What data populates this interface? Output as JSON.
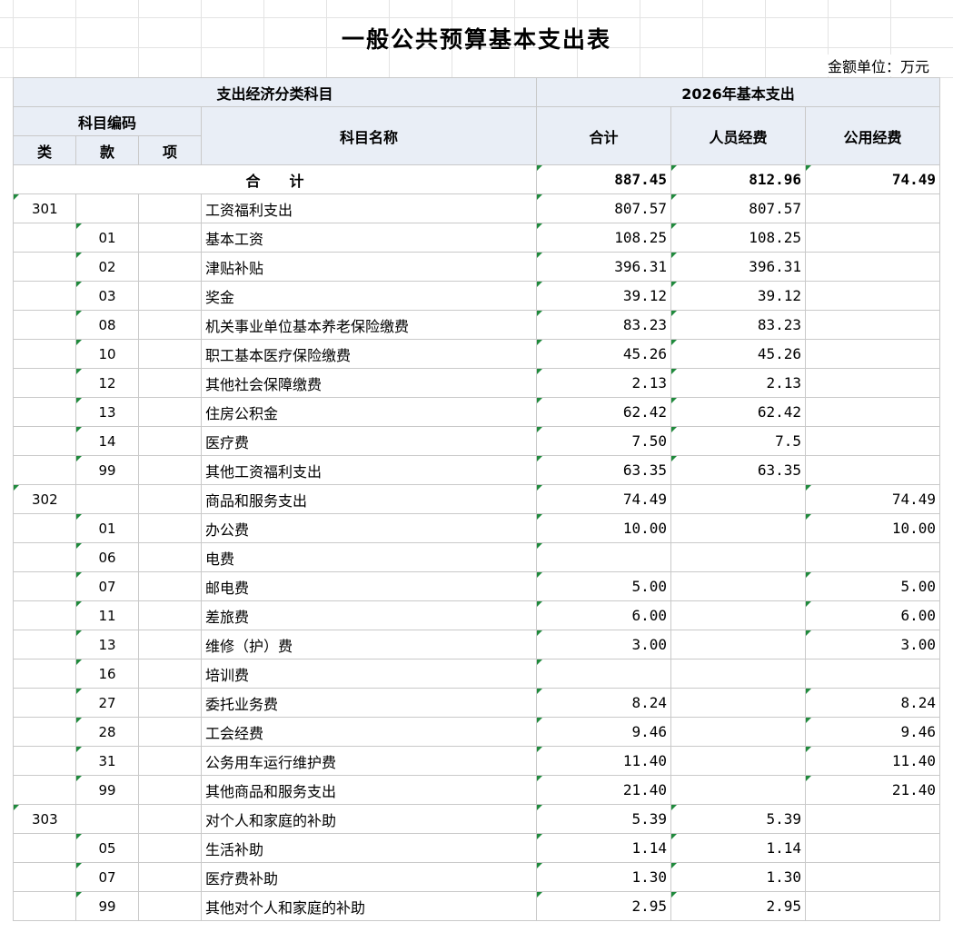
{
  "title": "一般公共预算基本支出表",
  "unit_label": "金额单位：万元",
  "header": {
    "econ_class": "支出经济分类科目",
    "year_group": "2026年基本支出",
    "code_group": "科目编码",
    "lei": "类",
    "kuan": "款",
    "xiang": "项",
    "subject_name": "科目名称",
    "total": "合计",
    "personnel": "人员经费",
    "public": "公用经费"
  },
  "total_row": {
    "label": "合　　计",
    "total": "887.45",
    "personnel": "812.96",
    "public": "74.49"
  },
  "rows": [
    {
      "lei": "301",
      "kuan": "",
      "name": "工资福利支出",
      "total": "807.57",
      "personnel": "807.57",
      "public": ""
    },
    {
      "lei": "",
      "kuan": "01",
      "name": "基本工资",
      "total": "108.25",
      "personnel": "108.25",
      "public": ""
    },
    {
      "lei": "",
      "kuan": "02",
      "name": "津贴补贴",
      "total": "396.31",
      "personnel": "396.31",
      "public": ""
    },
    {
      "lei": "",
      "kuan": "03",
      "name": "奖金",
      "total": "39.12",
      "personnel": "39.12",
      "public": ""
    },
    {
      "lei": "",
      "kuan": "08",
      "name": "机关事业单位基本养老保险缴费",
      "total": "83.23",
      "personnel": "83.23",
      "public": ""
    },
    {
      "lei": "",
      "kuan": "10",
      "name": "职工基本医疗保险缴费",
      "total": "45.26",
      "personnel": "45.26",
      "public": ""
    },
    {
      "lei": "",
      "kuan": "12",
      "name": "其他社会保障缴费",
      "total": "2.13",
      "personnel": "2.13",
      "public": ""
    },
    {
      "lei": "",
      "kuan": "13",
      "name": "住房公积金",
      "total": "62.42",
      "personnel": "62.42",
      "public": ""
    },
    {
      "lei": "",
      "kuan": "14",
      "name": "医疗费",
      "total": "7.50",
      "personnel": "7.5",
      "public": ""
    },
    {
      "lei": "",
      "kuan": "99",
      "name": "其他工资福利支出",
      "total": "63.35",
      "personnel": "63.35",
      "public": ""
    },
    {
      "lei": "302",
      "kuan": "",
      "name": "商品和服务支出",
      "total": "74.49",
      "personnel": "",
      "public": "74.49"
    },
    {
      "lei": "",
      "kuan": "01",
      "name": "办公费",
      "total": "10.00",
      "personnel": "",
      "public": "10.00"
    },
    {
      "lei": "",
      "kuan": "06",
      "name": "电费",
      "total": "",
      "personnel": "",
      "public": ""
    },
    {
      "lei": "",
      "kuan": "07",
      "name": "邮电费",
      "total": "5.00",
      "personnel": "",
      "public": "5.00"
    },
    {
      "lei": "",
      "kuan": "11",
      "name": "差旅费",
      "total": "6.00",
      "personnel": "",
      "public": "6.00"
    },
    {
      "lei": "",
      "kuan": "13",
      "name": "维修（护）费",
      "total": "3.00",
      "personnel": "",
      "public": "3.00"
    },
    {
      "lei": "",
      "kuan": "16",
      "name": "培训费",
      "total": "",
      "personnel": "",
      "public": ""
    },
    {
      "lei": "",
      "kuan": "27",
      "name": "委托业务费",
      "total": "8.24",
      "personnel": "",
      "public": "8.24"
    },
    {
      "lei": "",
      "kuan": "28",
      "name": "工会经费",
      "total": "9.46",
      "personnel": "",
      "public": "9.46"
    },
    {
      "lei": "",
      "kuan": "31",
      "name": "公务用车运行维护费",
      "total": "11.40",
      "personnel": "",
      "public": "11.40"
    },
    {
      "lei": "",
      "kuan": "99",
      "name": "其他商品和服务支出",
      "total": "21.40",
      "personnel": "",
      "public": "21.40"
    },
    {
      "lei": "303",
      "kuan": "",
      "name": "对个人和家庭的补助",
      "total": "5.39",
      "personnel": "5.39",
      "public": ""
    },
    {
      "lei": "",
      "kuan": "05",
      "name": "生活补助",
      "total": "1.14",
      "personnel": "1.14",
      "public": ""
    },
    {
      "lei": "",
      "kuan": "07",
      "name": "医疗费补助",
      "total": "1.30",
      "personnel": "1.30",
      "public": ""
    },
    {
      "lei": "",
      "kuan": "99",
      "name": "其他对个人和家庭的补助",
      "total": "2.95",
      "personnel": "2.95",
      "public": ""
    }
  ]
}
